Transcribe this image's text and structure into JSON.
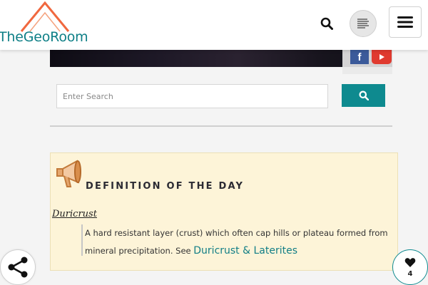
{
  "header": {
    "logo_text": "TheGeoRoom",
    "icons": {
      "search": "search-icon",
      "reader": "reader-mode-icon",
      "menu": "hamburger-menu-icon"
    }
  },
  "banner": {
    "social": {
      "facebook_glyph": "f",
      "youtube": "youtube-icon"
    }
  },
  "search": {
    "placeholder": "Enter Search",
    "value": ""
  },
  "definition": {
    "title": "DEFINITION OF THE DAY",
    "term": "Duricrust",
    "text": "A hard resistant layer (crust) which often cap hills or plateau formed from mineral precipitation. See ",
    "link_text": "Duricrust & Laterites"
  },
  "floating": {
    "like_count": "4"
  },
  "colors": {
    "brand_teal": "#0e8a8f",
    "logo_orange": "#f0683f",
    "card_bg": "#fdf4d8",
    "facebook": "#3b5a9a",
    "youtube": "#e03a2f"
  }
}
